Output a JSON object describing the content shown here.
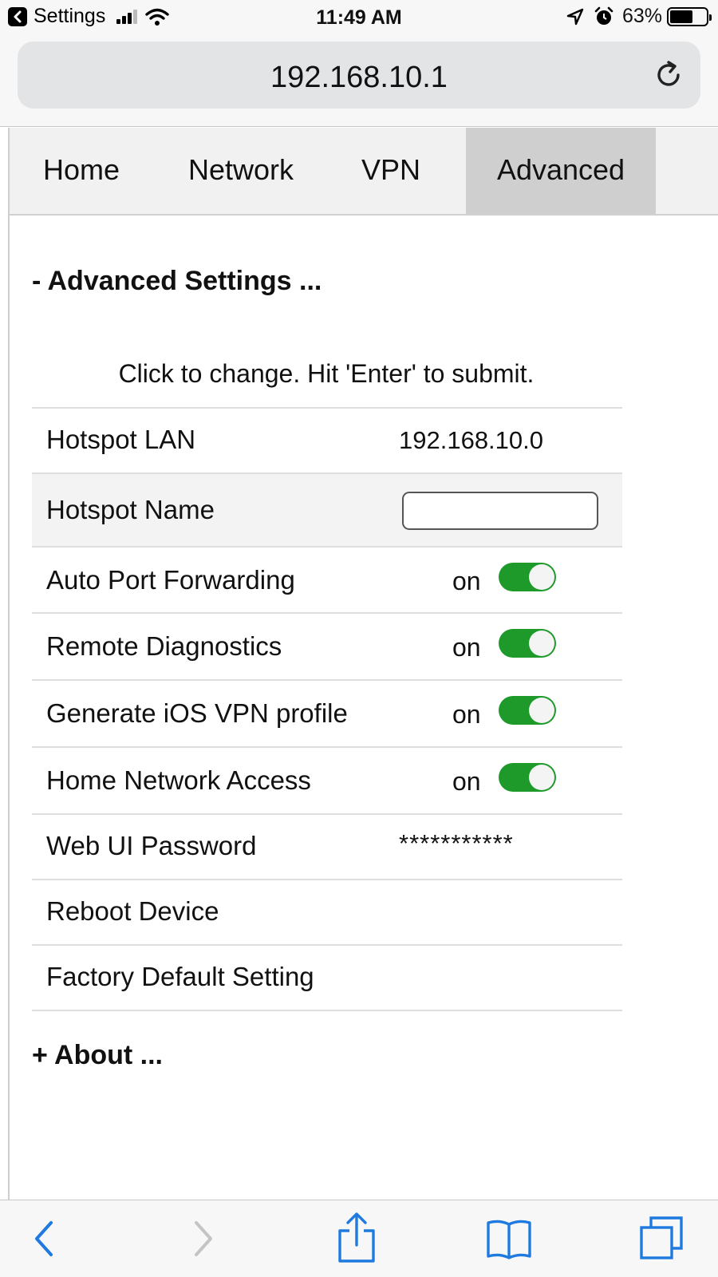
{
  "status_bar": {
    "back_app": "Settings",
    "time": "11:49 AM",
    "battery_pct": "63%",
    "battery_level": 0.63
  },
  "url_bar": {
    "url": "192.168.10.1"
  },
  "tabs": [
    {
      "label": "Home",
      "active": false
    },
    {
      "label": "Network",
      "active": false
    },
    {
      "label": "VPN",
      "active": false
    },
    {
      "label": "Advanced",
      "active": true
    }
  ],
  "advanced": {
    "title": "- Advanced Settings ...",
    "hint": "Click to change. Hit 'Enter' to submit.",
    "rows": [
      {
        "label": "Hotspot LAN",
        "value": "192.168.10.0"
      },
      {
        "label": "Hotspot Name",
        "value": ""
      },
      {
        "label": "Auto Port Forwarding",
        "state": "on",
        "enabled": true
      },
      {
        "label": "Remote Diagnostics",
        "state": "on",
        "enabled": true
      },
      {
        "label": "Generate iOS VPN profile",
        "state": "on",
        "enabled": true
      },
      {
        "label": "Home Network Access",
        "state": "on",
        "enabled": true
      },
      {
        "label": "Web UI Password",
        "value": "***********"
      },
      {
        "label": "Reboot Device"
      },
      {
        "label": "Factory Default Setting"
      }
    ]
  },
  "about": {
    "title": "+ About ..."
  },
  "colors": {
    "toggle_on": "#1e9a2a",
    "tab_active": "#cfcfcf",
    "safari_blue": "#1f7ae0"
  }
}
